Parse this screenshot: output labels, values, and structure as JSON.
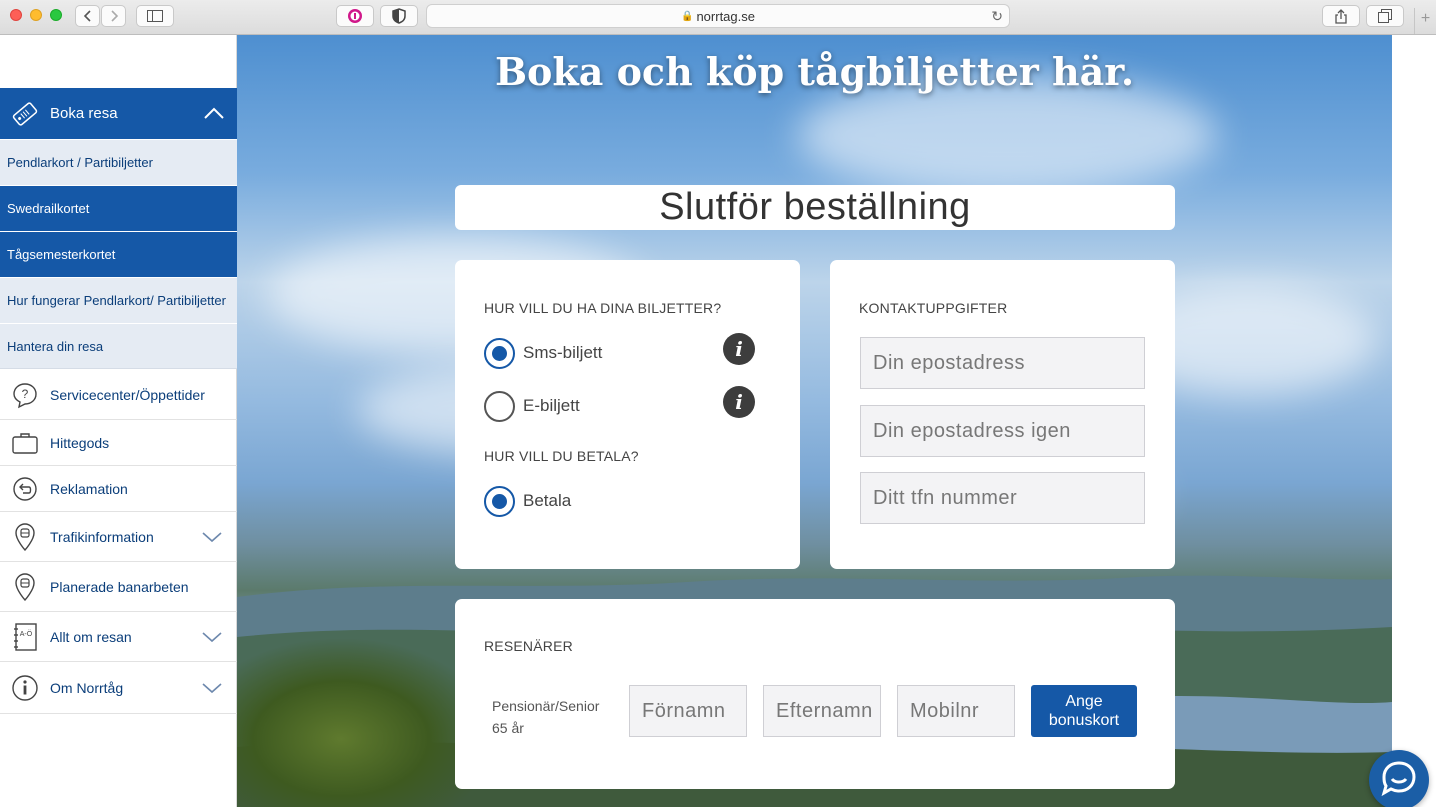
{
  "browser": {
    "url": "norrtag.se",
    "lock_icon": "lock-icon"
  },
  "sidebar": {
    "header": {
      "label": "Boka resa"
    },
    "subitems": [
      {
        "label": "Pendlarkort / Partibiljetter",
        "style": "light"
      },
      {
        "label": "Swedrailkortet",
        "style": "dark"
      },
      {
        "label": "Tågsemesterkortet",
        "style": "dark"
      },
      {
        "label": "Hur fungerar Pendlarkort/ Partibiljetter",
        "style": "light"
      },
      {
        "label": "Hantera din resa",
        "style": "light"
      }
    ],
    "items": [
      {
        "label": "Servicecenter/Öppettider",
        "icon": "question-bubble-icon"
      },
      {
        "label": "Hittegods",
        "icon": "briefcase-icon"
      },
      {
        "label": "Reklamation",
        "icon": "return-arrow-icon"
      },
      {
        "label": "Trafikinformation",
        "icon": "train-pin-icon",
        "expandable": true
      },
      {
        "label": "Planerade banarbeten",
        "icon": "train-pin-icon"
      },
      {
        "label": "Allt om resan",
        "icon": "a-o-book-icon",
        "expandable": true
      },
      {
        "label": "Om Norrtåg",
        "icon": "info-circle-icon",
        "expandable": true
      }
    ]
  },
  "hero": {
    "title": "Boka och köp tågbiljetter här."
  },
  "checkout": {
    "title": "Slutför beställning",
    "tickets": {
      "heading": "HUR VILL DU HA DINA BILJETTER?",
      "options": [
        {
          "label": "Sms-biljett",
          "selected": true
        },
        {
          "label": "E-biljett",
          "selected": false
        }
      ]
    },
    "payment": {
      "heading": "HUR VILL DU BETALA?",
      "option": {
        "label": "Betala",
        "selected": true
      }
    },
    "contact": {
      "heading": "KONTAKTUPPGIFTER",
      "email_placeholder": "Din epostadress",
      "email_again_placeholder": "Din epostadress igen",
      "phone_placeholder": "Ditt tfn nummer"
    },
    "travelers": {
      "heading": "RESENÄRER",
      "type_line1": "Pensionär/Senior",
      "type_line2": "65 år",
      "firstname_placeholder": "Förnamn",
      "lastname_placeholder": "Efternamn",
      "mobile_placeholder": "Mobilnr",
      "bonus_button_line1": "Ange",
      "bonus_button_line2": "bonuskort"
    }
  },
  "colors": {
    "brand": "#1558a7",
    "subitem_light": "#e5ebf3"
  }
}
